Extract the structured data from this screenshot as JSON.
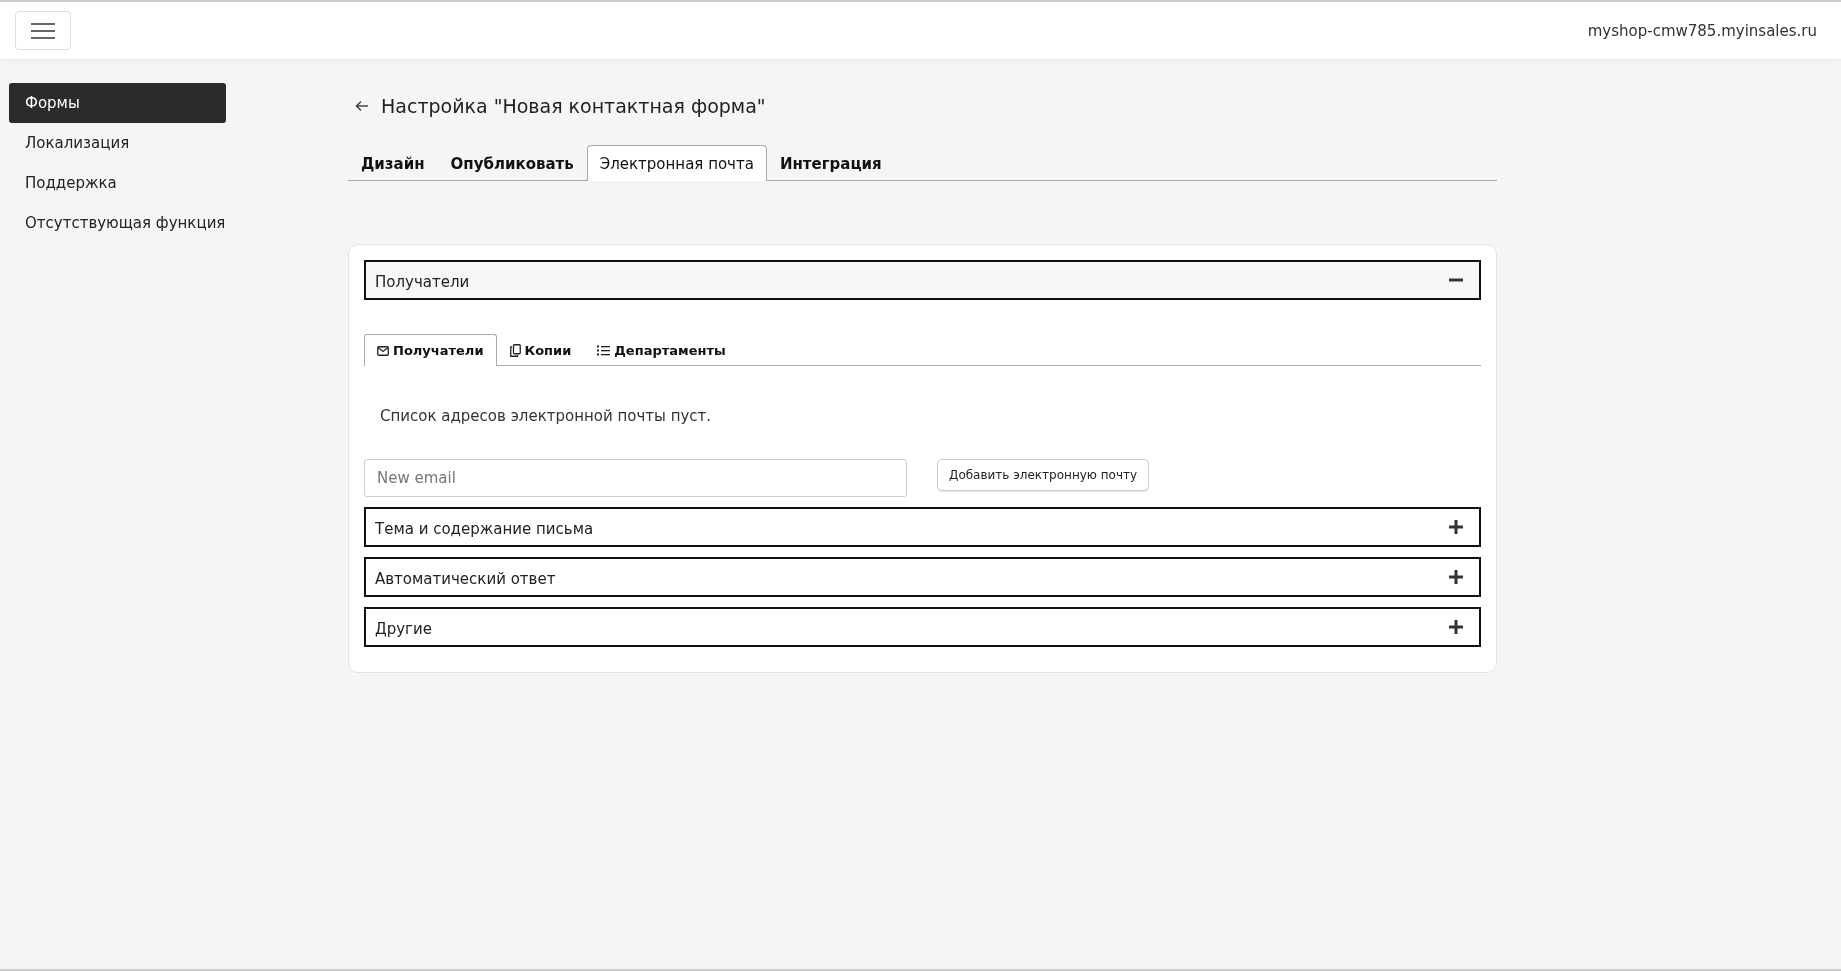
{
  "topbar": {
    "domain": "myshop-cmw785.myinsales.ru"
  },
  "sidebar": {
    "items": [
      {
        "label": "Формы",
        "selected": true
      },
      {
        "label": "Локализация",
        "selected": false
      },
      {
        "label": "Поддержка",
        "selected": false
      },
      {
        "label": "Отсутствующая функция",
        "selected": false
      }
    ]
  },
  "page": {
    "title": "Настройка \"Новая контактная форма\""
  },
  "tabs": [
    {
      "label": "Дизайн",
      "selected": false
    },
    {
      "label": "Опубликовать",
      "selected": false
    },
    {
      "label": "Электронная почта",
      "selected": true
    },
    {
      "label": "Интеграция",
      "selected": false
    }
  ],
  "sections": [
    {
      "title": "Получатели",
      "expanded": true,
      "subtabs": [
        {
          "label": "Получатели",
          "selected": true
        },
        {
          "label": "Копии",
          "selected": false
        },
        {
          "label": "Департаменты",
          "selected": false
        }
      ],
      "empty_message": "Список адресов электронной почты пуст.",
      "email_field": {
        "placeholder": "New email"
      },
      "add_button": "Добавить электронную почту"
    },
    {
      "title": "Тема и содержание письма",
      "expanded": false
    },
    {
      "title": "Автоматический ответ",
      "expanded": false
    },
    {
      "title": "Другие",
      "expanded": false
    }
  ]
}
